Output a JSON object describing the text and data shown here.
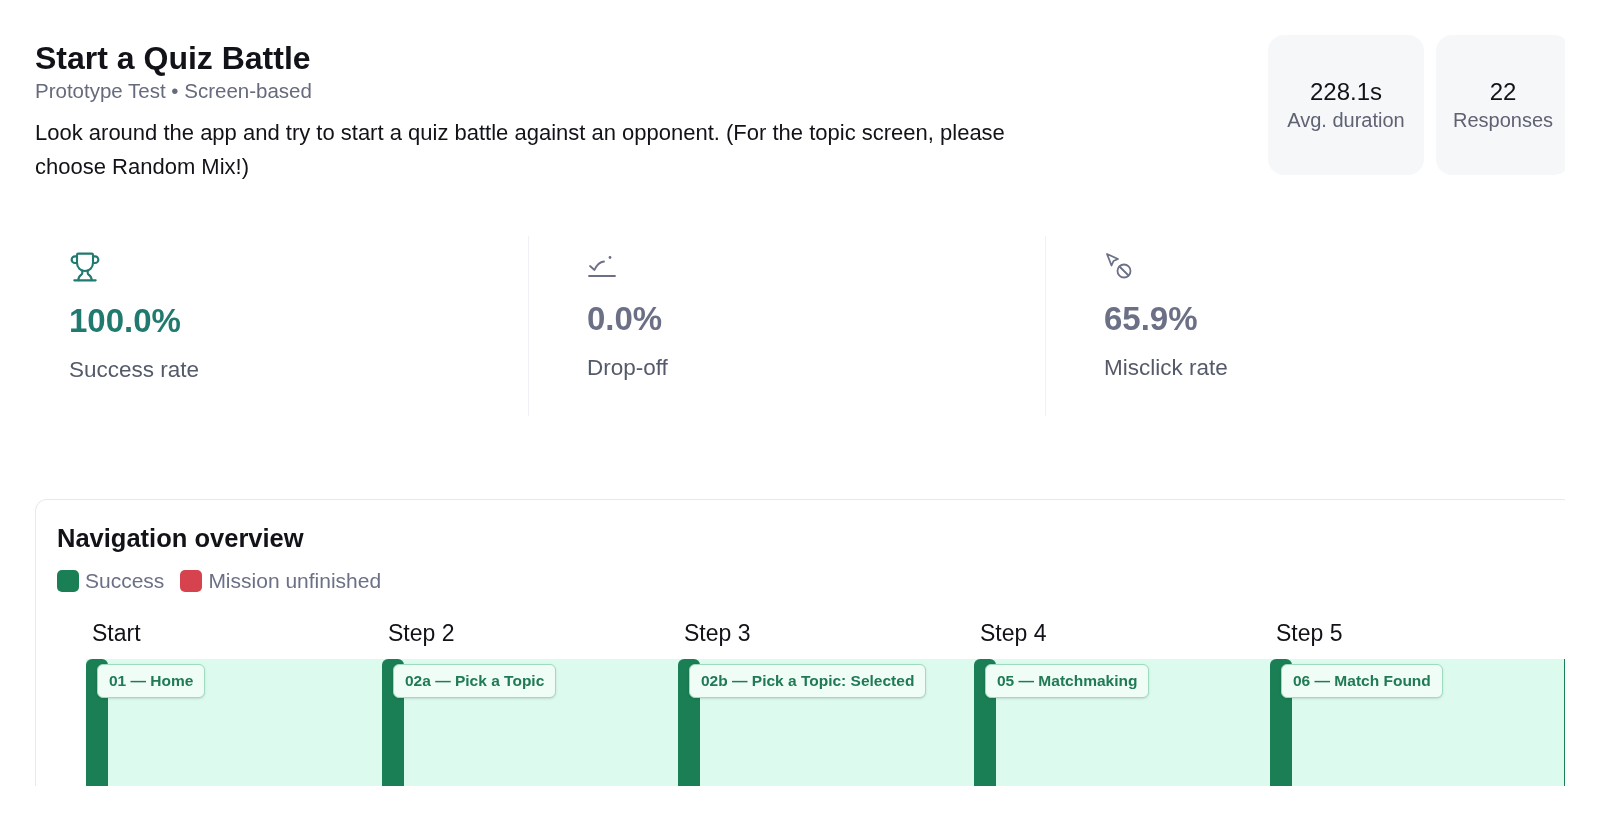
{
  "header": {
    "title": "Start a Quiz Battle",
    "subtitle": "Prototype Test • Screen-based",
    "description": "Look around the app and try to start a quiz battle against an opponent. (For the topic screen, please choose Random Mix!)"
  },
  "stats": [
    {
      "value": "228.1s",
      "label": "Avg. duration"
    },
    {
      "value": "22",
      "label": "Responses"
    }
  ],
  "metrics": [
    {
      "kind": "success",
      "value": "100.0%",
      "label": "Success rate",
      "color": "#217a6f"
    },
    {
      "kind": "drop_off",
      "value": "0.0%",
      "label": "Drop-off",
      "color": "#6c7086"
    },
    {
      "kind": "misclick",
      "value": "65.9%",
      "label": "Misclick rate",
      "color": "#6c7086"
    }
  ],
  "navigation": {
    "title": "Navigation overview",
    "legend": [
      {
        "label": "Success",
        "color": "#1a7f55"
      },
      {
        "label": "Mission unfinished",
        "color": "#d6434f"
      }
    ],
    "steps": [
      {
        "label": "Start",
        "screen": "01 — Home",
        "color": "#1a7f55"
      },
      {
        "label": "Step 2",
        "screen": "02a — Pick a Topic",
        "color": "#1a7f55"
      },
      {
        "label": "Step 3",
        "screen": "02b — Pick a Topic: Selected",
        "color": "#1a7f55"
      },
      {
        "label": "Step 4",
        "screen": "05 — Matchmaking",
        "color": "#1a7f55"
      },
      {
        "label": "Step 5",
        "screen": "06 — Match Found",
        "color": "#1a7f55"
      }
    ]
  }
}
